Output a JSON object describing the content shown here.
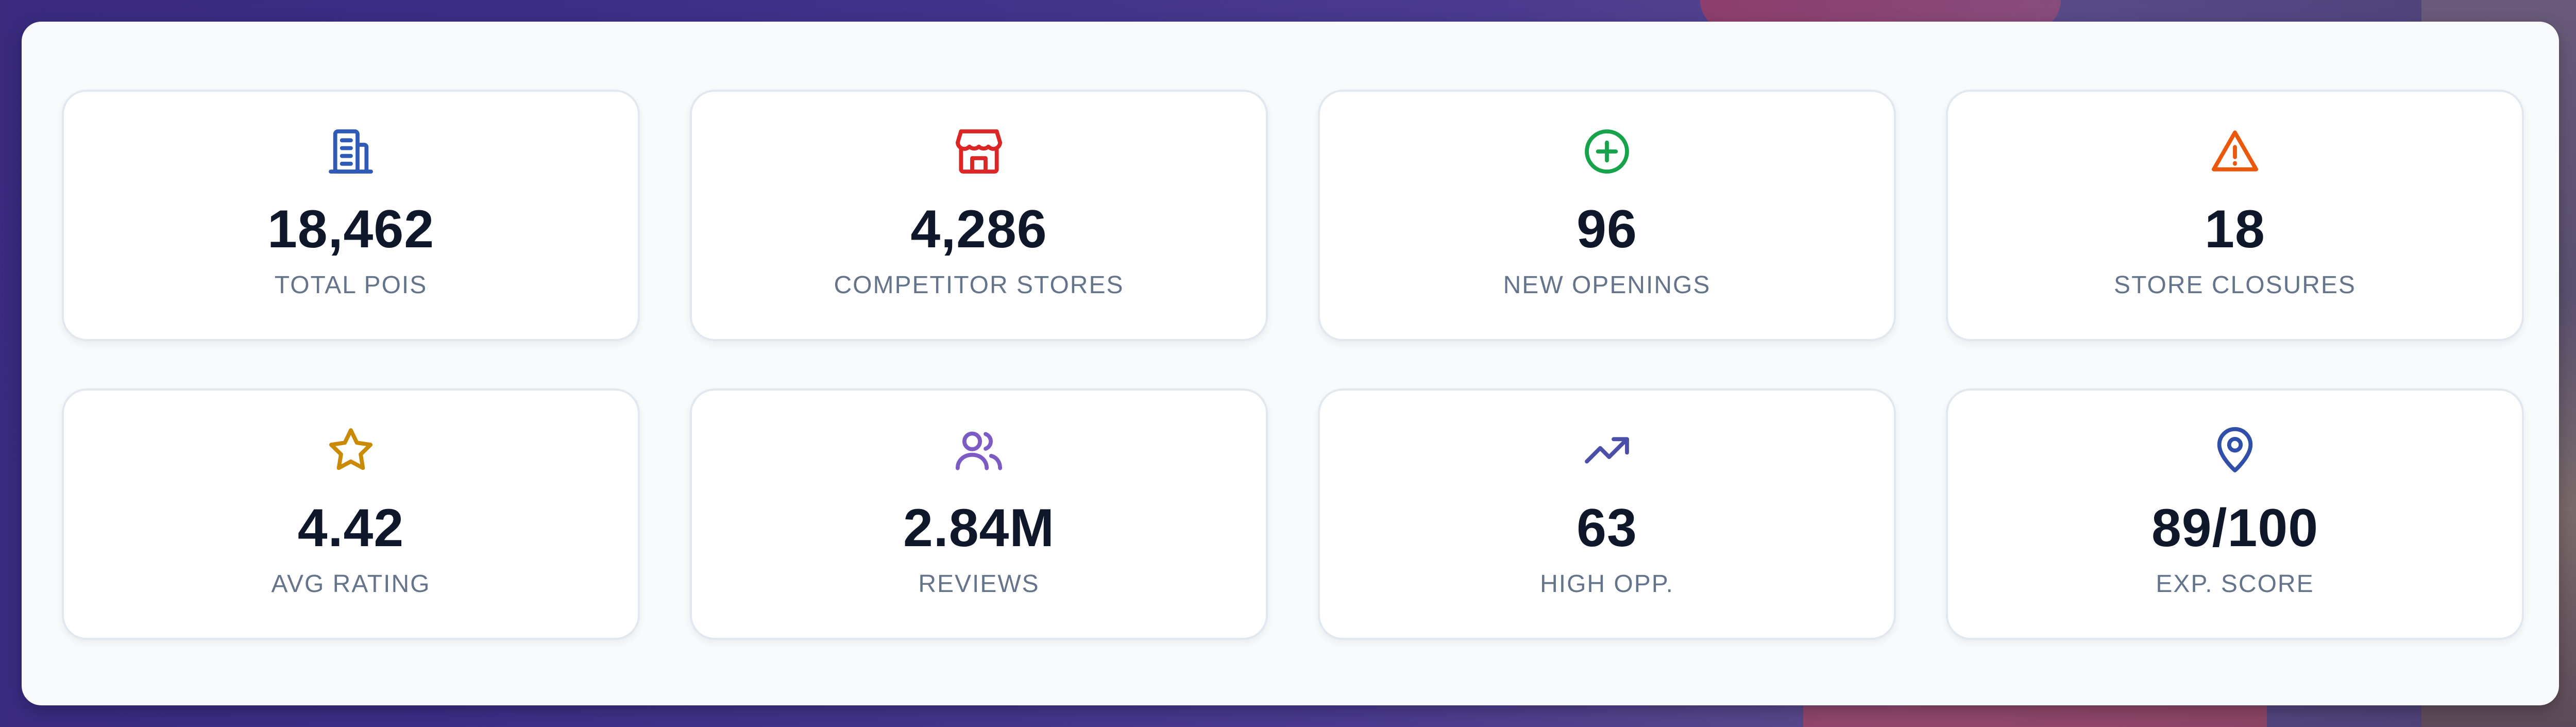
{
  "stats": [
    {
      "value": "18,462",
      "label": "TOTAL POIS",
      "icon": "building-icon",
      "color": "#2f5bb7"
    },
    {
      "value": "4,286",
      "label": "COMPETITOR STORES",
      "icon": "store-icon",
      "color": "#dc2626"
    },
    {
      "value": "96",
      "label": "NEW OPENINGS",
      "icon": "plus-circle-icon",
      "color": "#16a34a"
    },
    {
      "value": "18",
      "label": "STORE CLOSURES",
      "icon": "alert-triangle-icon",
      "color": "#ea580c"
    },
    {
      "value": "4.42",
      "label": "AVG RATING",
      "icon": "star-icon",
      "color": "#ca8a04"
    },
    {
      "value": "2.84M",
      "label": "REVIEWS",
      "icon": "users-icon",
      "color": "#7c5cc4"
    },
    {
      "value": "63",
      "label": "HIGH OPP.",
      "icon": "trending-up-icon",
      "color": "#4b4fa8"
    },
    {
      "value": "89/100",
      "label": "EXP. SCORE",
      "icon": "map-pin-icon",
      "color": "#2f4fa8"
    }
  ]
}
